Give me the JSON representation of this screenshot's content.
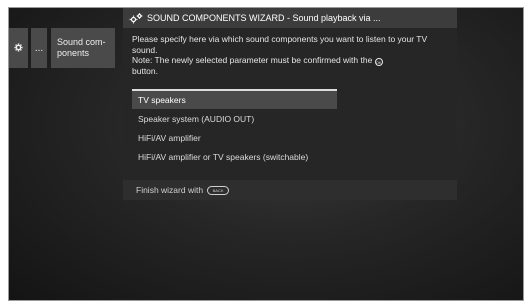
{
  "nav": {
    "dots_label": "...",
    "sound_label": "Sound com-\nponents"
  },
  "dialog": {
    "title": "SOUND COMPONENTS WIZARD - Sound playback via ...",
    "instruction": "Please specify here via which sound components you want to listen to your TV sound.",
    "note_prefix": "Note: The newly selected parameter must be confirmed with the",
    "note_suffix": "button.",
    "ok_key": "OK",
    "options": [
      {
        "label": "TV speakers",
        "selected": true
      },
      {
        "label": "Speaker system (AUDIO OUT)",
        "selected": false
      },
      {
        "label": "HiFi/AV amplifier",
        "selected": false
      },
      {
        "label": "HiFi/AV amplifier or TV speakers (switchable)",
        "selected": false
      }
    ],
    "footer_text": "Finish wizard with",
    "footer_key": "BACK"
  },
  "icons": {
    "nav_gear": "gear-icon",
    "header": "gears-icon"
  }
}
